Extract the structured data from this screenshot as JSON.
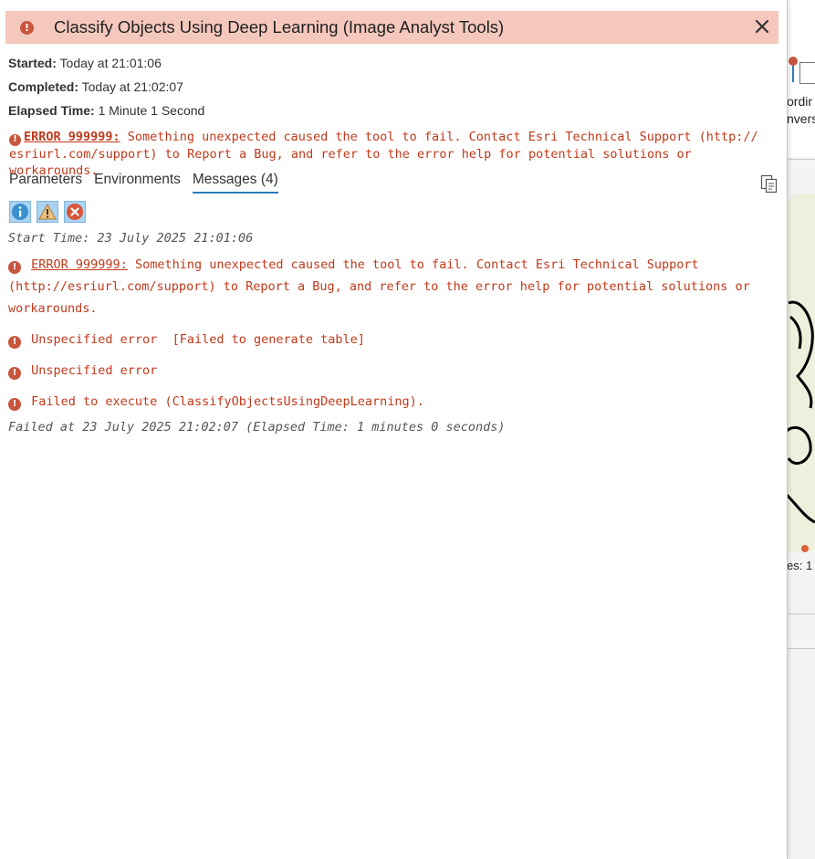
{
  "dialog": {
    "title": "Classify Objects Using Deep Learning (Image Analyst Tools)",
    "started_label": "Started:",
    "started_value": "Today at 21:01:06",
    "completed_label": "Completed:",
    "completed_value": "Today at 21:02:07",
    "elapsed_label": "Elapsed Time:",
    "elapsed_value": "1 Minute 1 Second",
    "summary_error_code": "ERROR 999999:",
    "summary_error_text": " Something unexpected caused the tool to fail. Contact Esri Technical Support (http:// esriurl.com/support) to Report a Bug, and refer to the error help for potential solutions or workarounds."
  },
  "tabs": [
    {
      "label": "Parameters"
    },
    {
      "label": "Environments"
    },
    {
      "label": "Messages (4)"
    }
  ],
  "messages": {
    "start_time": "Start Time: 23 July 2025 21:01:06",
    "error1_code": "ERROR 999999:",
    "error1_text": " Something unexpected caused the tool to fail. Contact Esri Technical Support (http://esriurl.com/support) to Report a Bug, and refer to the error help for potential solutions or workarounds.",
    "error2": "Unspecified error  [Failed to generate table]",
    "error3": "Unspecified error",
    "error4": "Failed to execute (ClassifyObjectsUsingDeepLearning).",
    "failed_at": "Failed at 23 July 2025 21:02:07 (Elapsed Time: 1 minutes 0 seconds)"
  },
  "background_app": {
    "text_line1": "ordir",
    "text_line2": "nvers",
    "count_text": "es: 1"
  },
  "colors": {
    "error": "#c0391b",
    "title_bar": "#f5c8bd",
    "tab_underline": "#2b7bb9"
  },
  "icons": {
    "title": "error-icon",
    "close": "close-icon",
    "copy": "copy-icon",
    "filters": [
      "info-icon",
      "warning-icon",
      "error-filter-icon"
    ]
  }
}
